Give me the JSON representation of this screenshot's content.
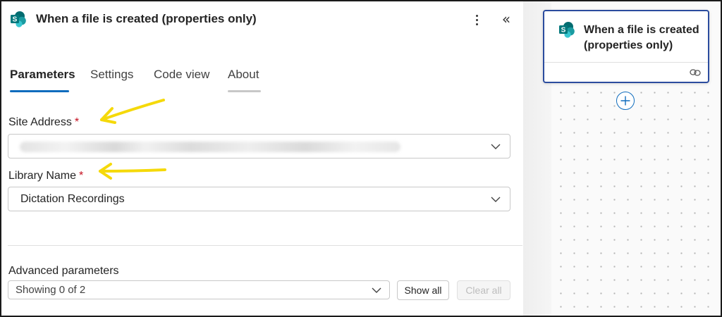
{
  "panel": {
    "title": "When a file is created (properties only)",
    "tabs": [
      {
        "label": "Parameters",
        "active": true
      },
      {
        "label": "Settings",
        "active": false
      },
      {
        "label": "Code view",
        "active": false
      },
      {
        "label": "About",
        "active": false
      }
    ],
    "site_address": {
      "label": "Site Address",
      "required_mark": "*",
      "value": ""
    },
    "library_name": {
      "label": "Library Name",
      "required_mark": "*",
      "value": "Dictation Recordings"
    },
    "advanced": {
      "label": "Advanced parameters",
      "value": "Showing 0 of 2",
      "show_all_label": "Show all",
      "clear_all_label": "Clear all"
    }
  },
  "canvas": {
    "node_title": "When a file is created (properties only)"
  },
  "icons": {
    "connector": "sharepoint-icon",
    "more": "more-vertical-icon",
    "collapse": "double-chevron-left-icon",
    "dropdown": "chevron-down-icon",
    "link": "link-icon",
    "add": "plus-circle-icon"
  },
  "colors": {
    "accent": "#0f6cbd",
    "sharepoint_dark": "#036c70",
    "sharepoint_mid": "#1a9ba1",
    "sharepoint_light": "#37c6d0",
    "required": "#c50f1f",
    "annotation_arrow": "#f5d90a",
    "node_border": "#2b4c9e"
  }
}
